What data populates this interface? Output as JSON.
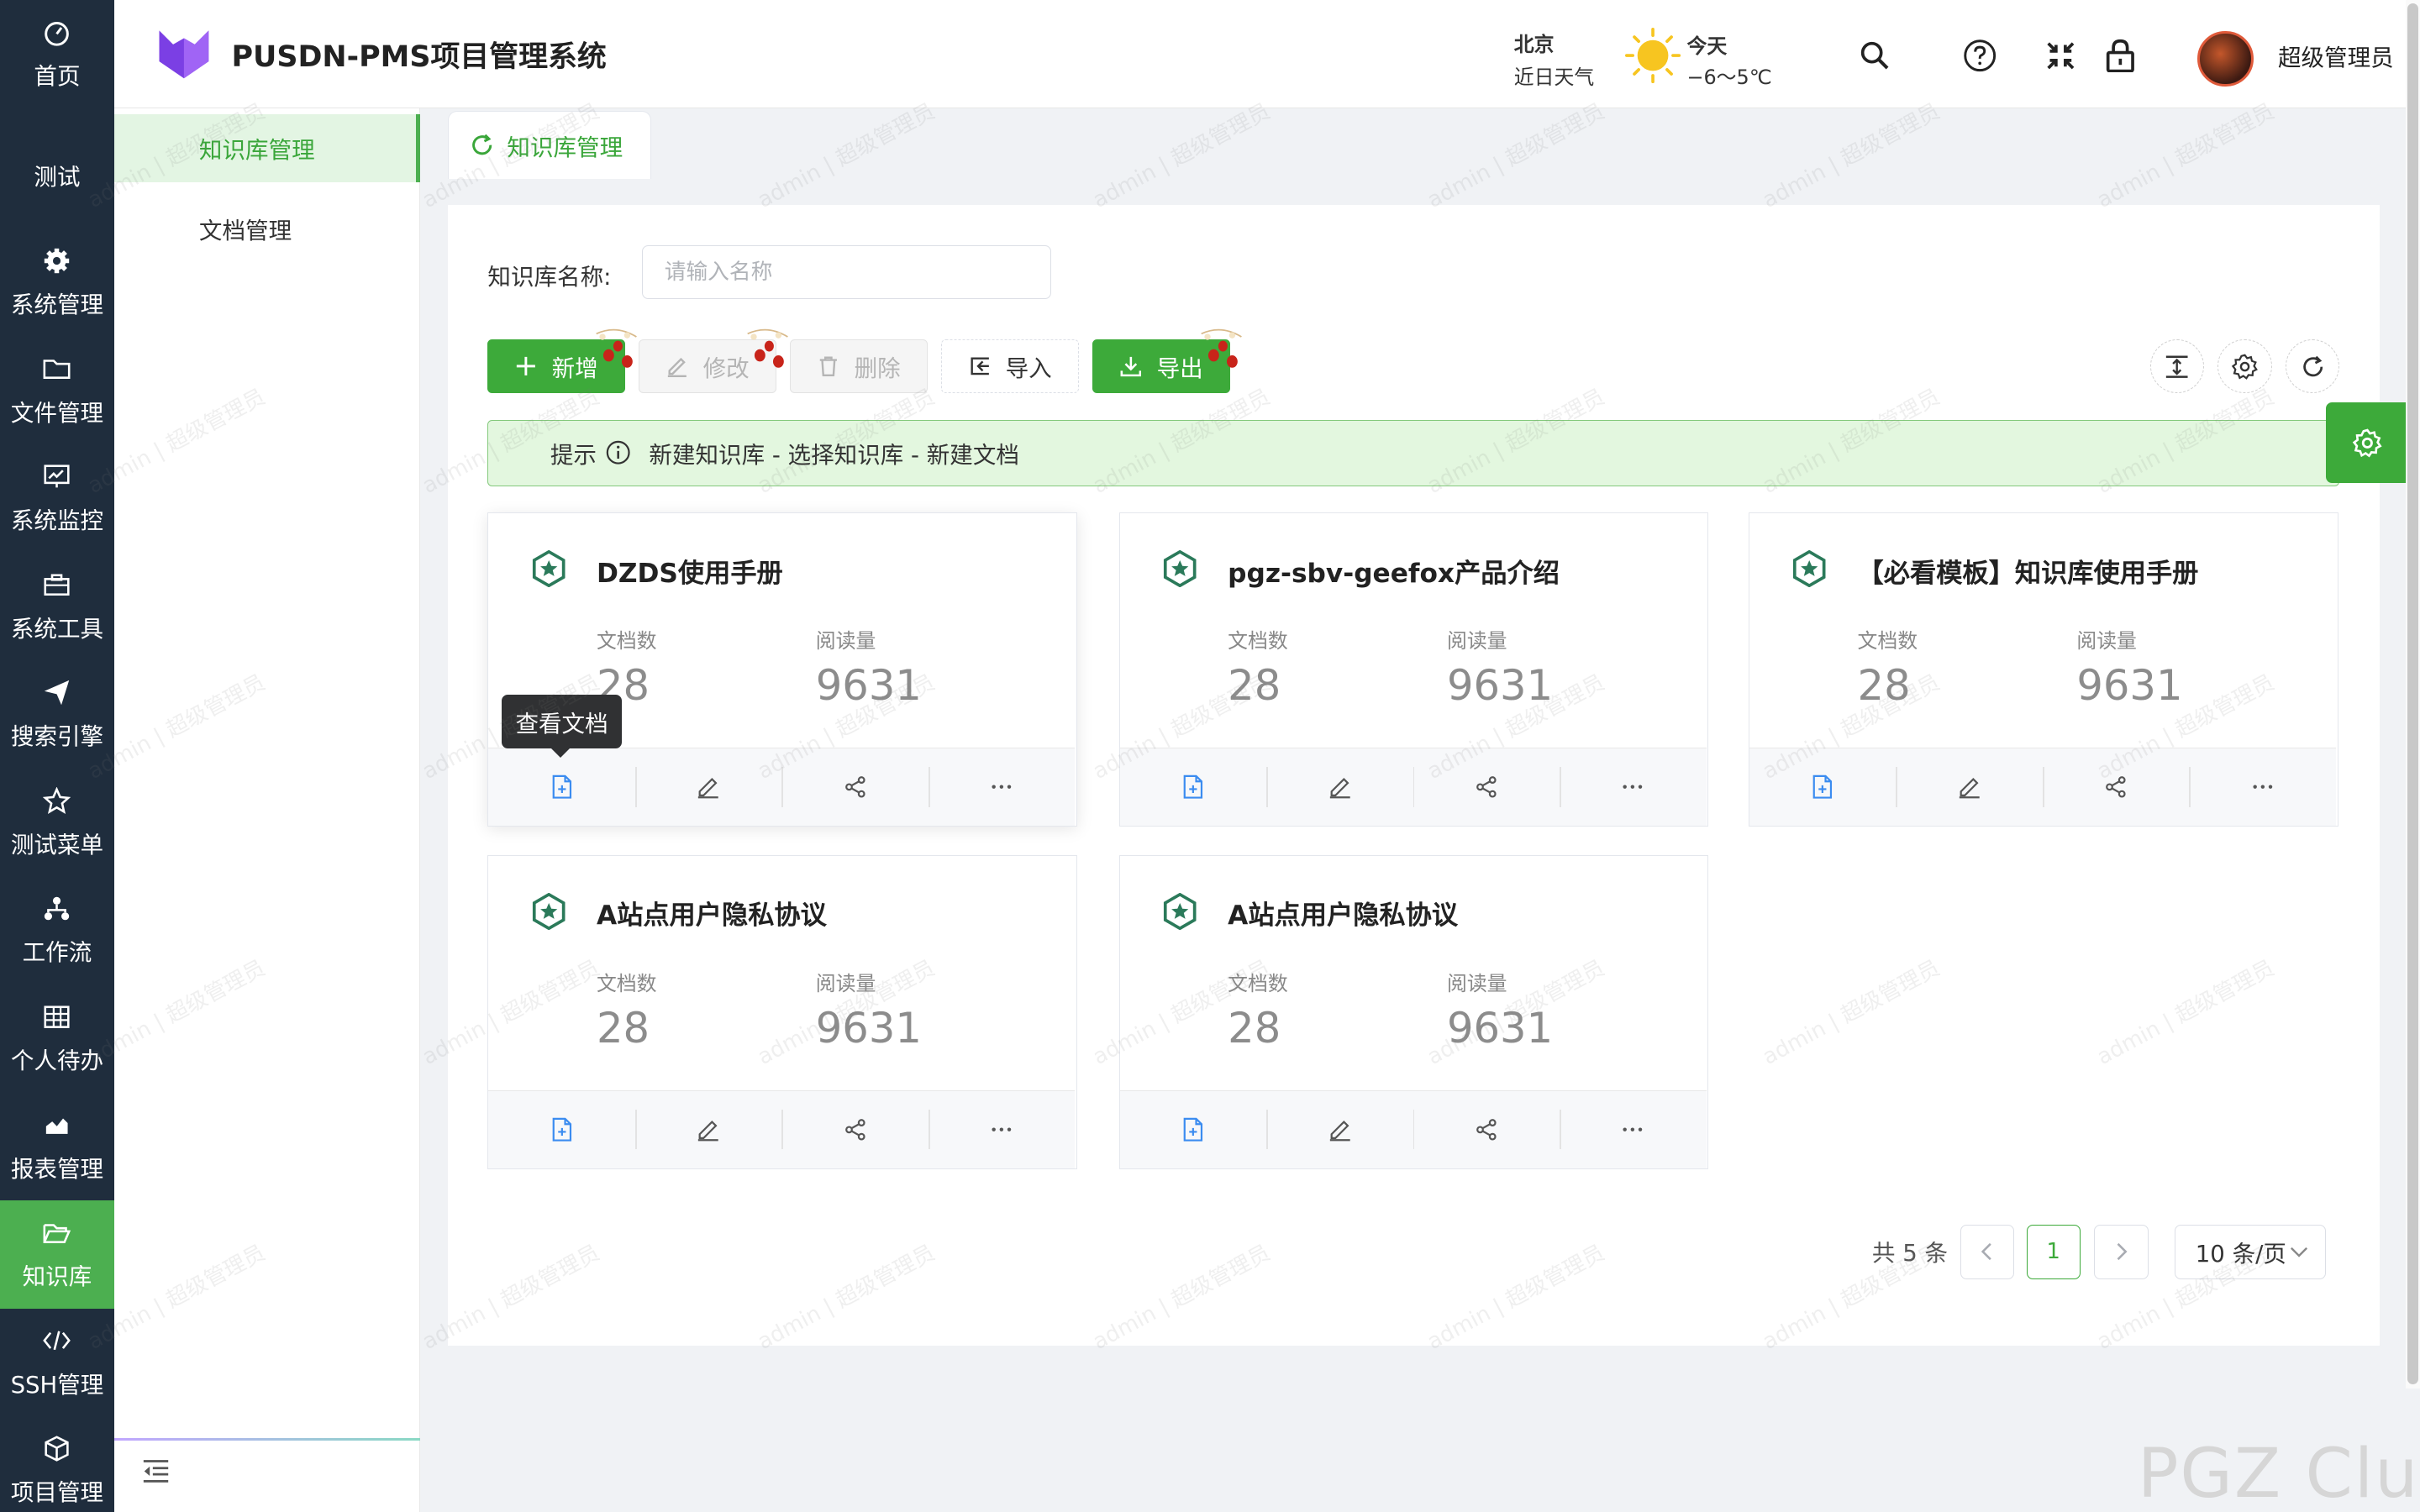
{
  "app": {
    "title": "PUSDN-PMS项目管理系统"
  },
  "rail": [
    {
      "label": "首页",
      "icon": "dashboard-icon"
    },
    {
      "label": "测试",
      "icon": ""
    },
    {
      "label": "系统管理",
      "icon": "gear-icon"
    },
    {
      "label": "文件管理",
      "icon": "folder-icon"
    },
    {
      "label": "系统监控",
      "icon": "monitor-icon"
    },
    {
      "label": "系统工具",
      "icon": "toolbox-icon"
    },
    {
      "label": "搜索引擎",
      "icon": "paper-plane-icon"
    },
    {
      "label": "测试菜单",
      "icon": "star-icon"
    },
    {
      "label": "工作流",
      "icon": "flow-icon"
    },
    {
      "label": "个人待办",
      "icon": "grid-icon"
    },
    {
      "label": "报表管理",
      "icon": "chart-icon"
    },
    {
      "label": "知识库",
      "icon": "folder-open-icon"
    },
    {
      "label": "SSH管理",
      "icon": "code-icon"
    },
    {
      "label": "项目管理",
      "icon": "cube-icon"
    }
  ],
  "weather": {
    "city": "北京",
    "sub": "近日天气",
    "today": "今天",
    "temp": "−6～5℃"
  },
  "user": {
    "name": "超级管理员"
  },
  "subnav": {
    "items": [
      "知识库管理",
      "文档管理"
    ]
  },
  "tabs": [
    "知识库管理"
  ],
  "search": {
    "label": "知识库名称:",
    "placeholder": "请输入名称",
    "value": ""
  },
  "toolbar": {
    "add": "新增",
    "edit": "修改",
    "delete": "删除",
    "import": "导入",
    "export": "导出"
  },
  "tip": {
    "label": "提示",
    "text": "新建知识库 - 选择知识库 - 新建文档"
  },
  "cards": [
    {
      "title": "DZDS使用手册",
      "doc_label": "文档数",
      "docs": "28",
      "read_label": "阅读量",
      "reads": "9631"
    },
    {
      "title": "pgz-sbv-geefox产品介绍",
      "doc_label": "文档数",
      "docs": "28",
      "read_label": "阅读量",
      "reads": "9631"
    },
    {
      "title": "【必看模板】知识库使用手册",
      "doc_label": "文档数",
      "docs": "28",
      "read_label": "阅读量",
      "reads": "9631"
    },
    {
      "title": "A站点用户隐私协议",
      "doc_label": "文档数",
      "docs": "28",
      "read_label": "阅读量",
      "reads": "9631"
    },
    {
      "title": "A站点用户隐私协议",
      "doc_label": "文档数",
      "docs": "28",
      "read_label": "阅读量",
      "reads": "9631"
    }
  ],
  "tooltip": "查看文档",
  "pagination": {
    "total": "共 5 条",
    "current": "1",
    "size": "10 条/页"
  },
  "watermark": {
    "text": "admin | 超级管理员",
    "corner": "PGZ Club"
  },
  "colors": {
    "primary": "#3daa3a",
    "rail": "#1f2d3d",
    "tip_bg": "#e3f7df"
  }
}
